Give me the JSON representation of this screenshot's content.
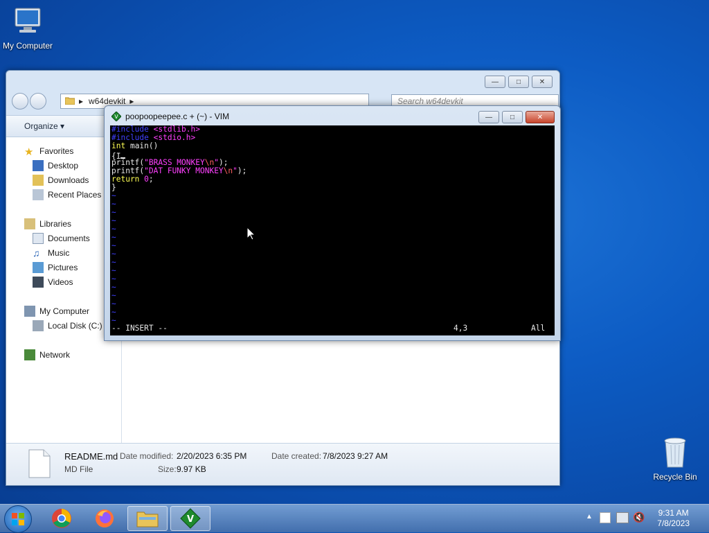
{
  "desktop": {
    "icons": [
      {
        "label": "My Computer",
        "icon": "computer-icon"
      },
      {
        "label": "Recycle Bin",
        "icon": "recycle-bin-icon"
      }
    ]
  },
  "explorer": {
    "breadcrumb": "w64devkit",
    "search_placeholder": "Search w64devkit",
    "organize_label": "Organize",
    "nav": {
      "favorites": "Favorites",
      "desktop": "Desktop",
      "downloads": "Downloads",
      "recent": "Recent Places",
      "libraries": "Libraries",
      "documents": "Documents",
      "music": "Music",
      "pictures": "Pictures",
      "videos": "Videos",
      "computer": "My Computer",
      "local_disk": "Local Disk (C:)",
      "network": "Network"
    },
    "details": {
      "name": "README.md",
      "type": "MD File",
      "modified_label": "Date modified:",
      "modified": "2/20/2023 6:35 PM",
      "size_label": "Size:",
      "size": "9.97 KB",
      "created_label": "Date created:",
      "created": "7/8/2023 9:27 AM"
    }
  },
  "vim": {
    "title": "poopoopeepee.c + (~) - VIM",
    "lines": [
      {
        "pre": "#include",
        "inc": " <stdlib.h>"
      },
      {
        "pre": "#include",
        "inc": " <stdio.h>"
      },
      {
        "kw": "int",
        "def": " main()"
      },
      {
        "def": "{I"
      },
      {
        "def": "printf(",
        "str": "\"BRASS MONKEY",
        "esc": "\\n",
        "str2": "\"",
        "def2": ");"
      },
      {
        "def": "printf(",
        "str": "\"DAT FUNKY MONKEY",
        "esc": "\\n",
        "str2": "\"",
        "def2": ");"
      },
      {
        "kw": "return",
        "num": " 0",
        "def": ";"
      },
      {
        "def": "}"
      }
    ],
    "mode": "-- INSERT --",
    "position": "4,3",
    "scroll": "All"
  },
  "taskbar": {
    "time": "9:31 AM",
    "date": "7/8/2023"
  }
}
